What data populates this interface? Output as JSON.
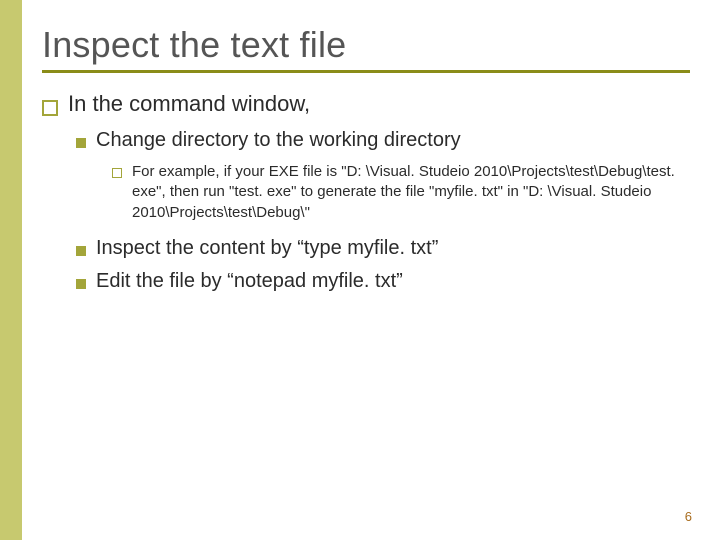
{
  "title": "Inspect the text file",
  "lvl1": {
    "text": "In the command window,"
  },
  "lvl2a": {
    "text": "Change directory to the working directory"
  },
  "lvl3a": {
    "text": "For example, if your EXE file is \"D: \\Visual. Studeio 2010\\Projects\\test\\Debug\\test. exe\", then run \"test. exe\" to generate the file \"myfile. txt\" in \"D: \\Visual. Studeio 2010\\Projects\\test\\Debug\\\""
  },
  "lvl2b": {
    "text": "Inspect the content by “type myfile. txt”"
  },
  "lvl2c": {
    "text": "Edit the file by “notepad myfile. txt”"
  },
  "page_number": "6"
}
